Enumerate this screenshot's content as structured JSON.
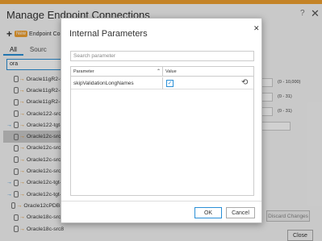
{
  "window": {
    "title": "Manage Endpoint Connections",
    "help": "?",
    "close": "✕"
  },
  "toolbar": {
    "plus": "+",
    "new_badge": "New",
    "label": "Endpoint Conne"
  },
  "tabs": [
    {
      "label": "All"
    },
    {
      "label": "Sourc"
    }
  ],
  "search": {
    "value": "ora"
  },
  "list": [
    {
      "label": "Oracle11gR2-sr",
      "linked": false,
      "selected": false
    },
    {
      "label": "Oracle11gR2-sr",
      "linked": false,
      "selected": false
    },
    {
      "label": "Oracle11gR2-sr",
      "linked": false,
      "selected": false
    },
    {
      "label": "Oracle122-src-",
      "linked": false,
      "selected": false
    },
    {
      "label": "Oracle122-tgt-",
      "linked": true,
      "selected": false
    },
    {
      "label": "Oracle12c-src-",
      "linked": false,
      "selected": true
    },
    {
      "label": "Oracle12c-src8",
      "linked": false,
      "selected": false
    },
    {
      "label": "Oracle12c-src8",
      "linked": false,
      "selected": false
    },
    {
      "label": "Oracle12c-src8",
      "linked": false,
      "selected": false
    },
    {
      "label": "Oracle12c-tgt-",
      "linked": true,
      "selected": false
    },
    {
      "label": "Oracle12c-tgt-",
      "linked": true,
      "selected": false
    },
    {
      "label": "Oracle12cPDB-s",
      "linked": false,
      "selected": false
    },
    {
      "label": "Oracle18c-src8",
      "linked": false,
      "selected": false
    },
    {
      "label": "Oracle18c-src8",
      "linked": false,
      "selected": false
    }
  ],
  "right_panel": {
    "range1": "(0 - 10,000)",
    "range2": "(0 - 31)",
    "range3": "(0 - 31)",
    "discard": "Discard Changes",
    "close": "Close"
  },
  "modal": {
    "title": "Internal Parameters",
    "close": "✕",
    "search_placeholder": "Search parameter",
    "columns": {
      "parameter": "Parameter",
      "value": "Value",
      "sort": "⌃"
    },
    "rows": [
      {
        "name": "skipValidationLongNames",
        "checked": true,
        "check_glyph": "✓",
        "reset_glyph": "⟲"
      }
    ],
    "ok": "OK",
    "cancel": "Cancel"
  }
}
